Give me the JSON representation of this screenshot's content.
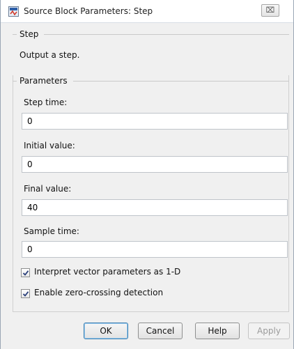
{
  "window": {
    "title": "Source Block Parameters: Step",
    "close_glyph": "⌧"
  },
  "block": {
    "group_title": "Step",
    "description": "Output a step."
  },
  "parameters": {
    "group_title": "Parameters",
    "step_time": {
      "label": "Step time:",
      "value": "0"
    },
    "initial_value": {
      "label": "Initial value:",
      "value": "0"
    },
    "final_value": {
      "label": "Final value:",
      "value": "40"
    },
    "sample_time": {
      "label": "Sample time:",
      "value": "0"
    },
    "interpret_vector": {
      "label": "Interpret vector parameters as 1-D",
      "checked": true
    },
    "zero_crossing": {
      "label": "Enable zero-crossing detection",
      "checked": true
    }
  },
  "buttons": {
    "ok": "OK",
    "cancel": "Cancel",
    "help": "Help",
    "apply": "Apply"
  },
  "icons": {
    "app": "simulink-block-icon",
    "close": "close-icon",
    "checkmark": "checkmark-icon"
  },
  "colors": {
    "default_button_border": "#3c7fb1",
    "disabled_text": "#9a9a9a"
  }
}
